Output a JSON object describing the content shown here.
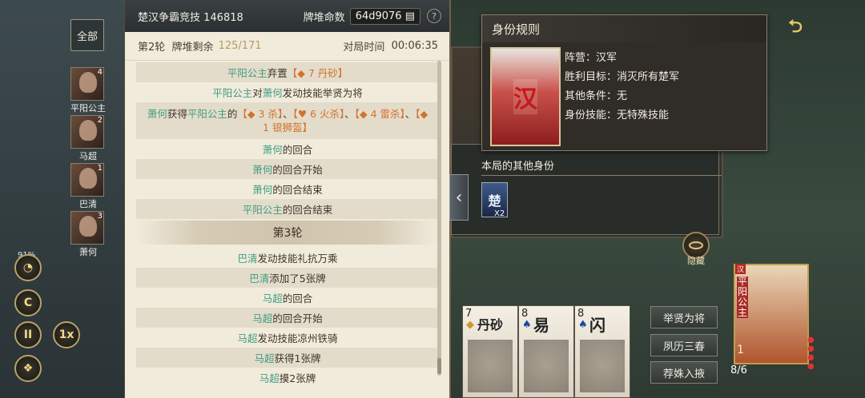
{
  "left": {
    "all_label": "全部",
    "players": [
      {
        "name": "平阳公主",
        "badge": "4"
      },
      {
        "name": "马超",
        "badge": "2"
      },
      {
        "name": "巴清",
        "badge": "1"
      },
      {
        "name": "萧何",
        "badge": "3"
      }
    ],
    "speed_percent": "91%",
    "speed_label": "1x",
    "play_icon": "C",
    "pause_icon": "II"
  },
  "log": {
    "title": "楚汉争霸竞技 146818",
    "deck_label": "牌堆命数",
    "deck_seed": "64d9076",
    "help": "?",
    "round_label": "第2轮",
    "remaining_label": "牌堆剩余",
    "remaining_value": "125/171",
    "time_label": "对局时间",
    "time_value": "00:06:35",
    "e1_name": "平阳公主",
    "e1_verb": "弃置",
    "e1_card": "【◆ 7 丹砂】",
    "e2_name": "平阳公主",
    "e2_mid": "对",
    "e2_target": "萧何",
    "e2_rest": "发动技能举贤为将",
    "e3_name": "萧何",
    "e3_mid": "获得",
    "e3_target": "平阳公主",
    "e3_of": "的",
    "e3_c1": "【◆ 3 杀】",
    "e3_sep1": "、",
    "e3_c2": "【♥ 6 火杀】",
    "e3_sep2": "、",
    "e3_c3": "【◆ 4 雷杀】",
    "e3_sep3": "、",
    "e3_c4": "【◆ 1 银狮盔】",
    "e4_name": "萧何",
    "e4_rest": "的回合",
    "e5_name": "萧何",
    "e5_rest": "的回合开始",
    "e6_name": "萧何",
    "e6_rest": "的回合结束",
    "e7_name": "平阳公主",
    "e7_rest": "的回合结束",
    "round3": "第3轮",
    "e8_name": "巴清",
    "e8_rest": "发动技能礼抗万乘",
    "e9_name": "巴清",
    "e9_rest": "添加了5张牌",
    "e10_name": "马超",
    "e10_rest": "的回合",
    "e11_name": "马超",
    "e11_rest": "的回合开始",
    "e12_name": "马超",
    "e12_rest": "发动技能凉州铁骑",
    "e13_name": "马超",
    "e13_rest": "获得1张牌",
    "e14_name": "马超",
    "e14_rest": "摸2张牌"
  },
  "identity": {
    "title": "身份规则",
    "card_char": "汉",
    "camp": "阵营：汉军",
    "goal": "胜利目标：消灭所有楚军",
    "other_cond": "其他条件：无",
    "skill": "身份技能：无特殊技能",
    "others_label": "本局的其他身份",
    "chu_char": "楚",
    "chu_count": "X2"
  },
  "right": {
    "hide_label": "隐藏",
    "skill_buttons": [
      "举贤为将",
      "夙历三春",
      "荐姝入掖"
    ],
    "self_name": "平阳公主",
    "self_faction": "汉",
    "self_handcount": "8/6",
    "self_one": "1",
    "cards": [
      {
        "rank": "7",
        "suit": "◆",
        "name": "丹砂"
      },
      {
        "rank": "8",
        "suit": "♠",
        "name": "易"
      },
      {
        "rank": "8",
        "suit": "♠",
        "name": "闪"
      }
    ]
  }
}
